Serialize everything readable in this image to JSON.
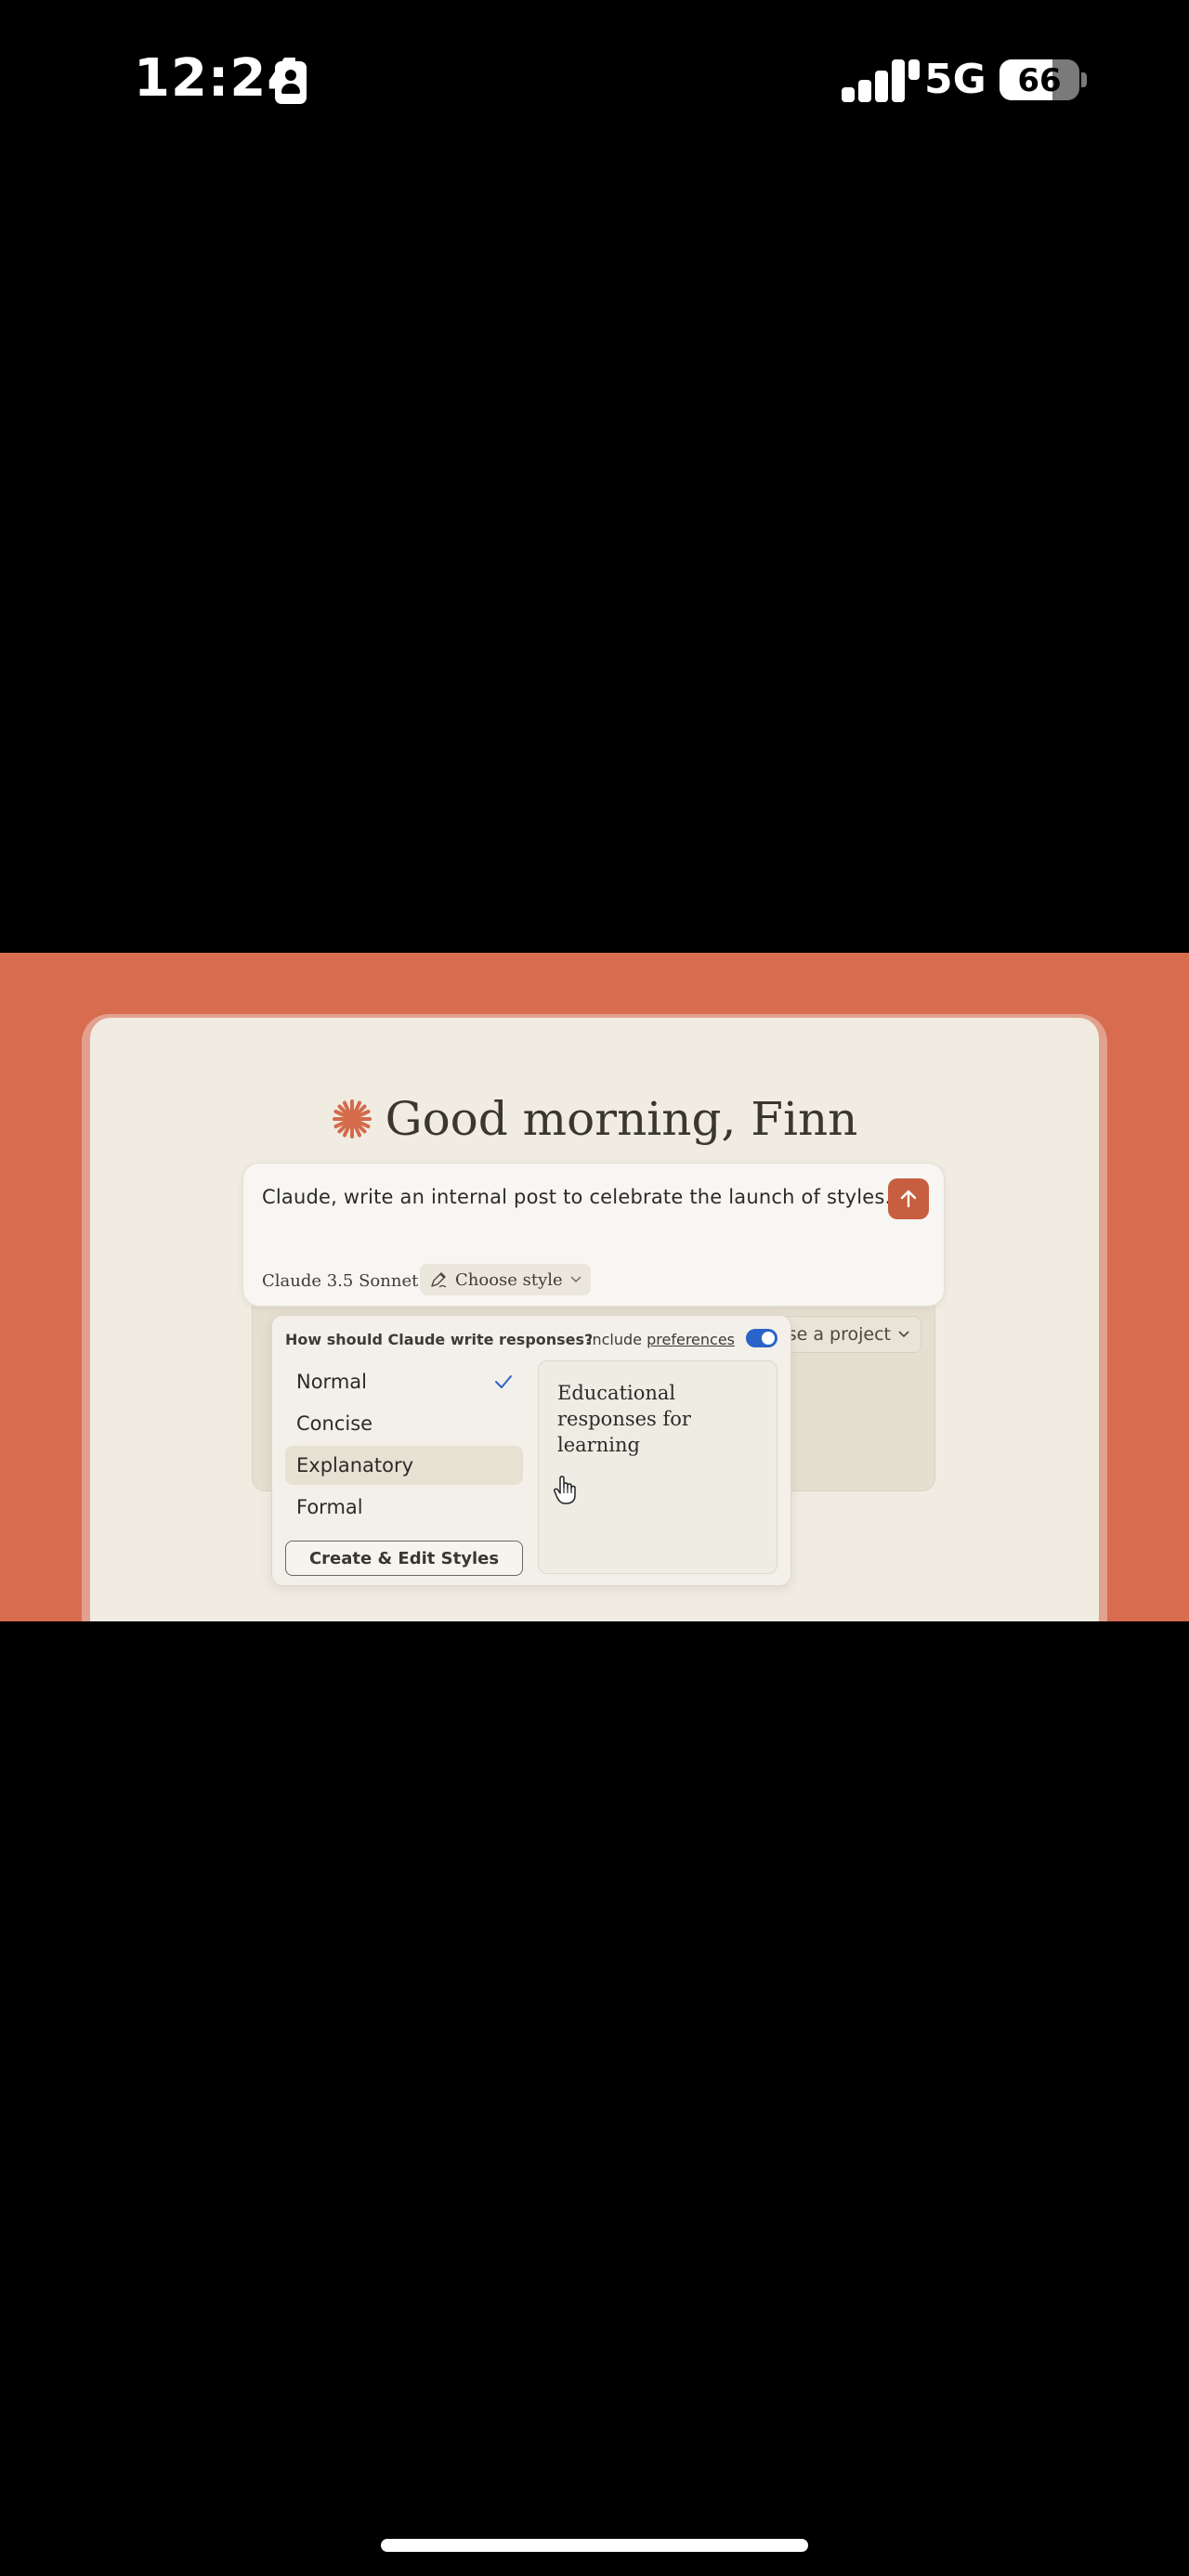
{
  "status_bar": {
    "time": "12:24",
    "network": "5G",
    "battery": "66",
    "battery_level": 0.66
  },
  "app": {
    "greeting": "Good morning, Finn",
    "composer": {
      "prompt": "Claude, write an internal post to celebrate the launch of styles.",
      "model_label": "Claude 3.5 Sonnet",
      "style_label": "Choose style"
    },
    "project_label": "Use a project",
    "style_menu": {
      "question": "How should Claude write responses?",
      "include_prefix": "Include",
      "include_link": "preferences",
      "include_enabled": true,
      "options": [
        {
          "label": "Normal",
          "selected": true
        },
        {
          "label": "Concise"
        },
        {
          "label": "Explanatory",
          "hovered": true
        },
        {
          "label": "Formal"
        }
      ],
      "create_button": "Create & Edit Styles",
      "preview": "Educational responses for learning"
    }
  },
  "colors": {
    "accent": "#d86c4f",
    "send_button": "#c75e40",
    "toggle": "#2a64c8",
    "background": "#f0ece2"
  }
}
